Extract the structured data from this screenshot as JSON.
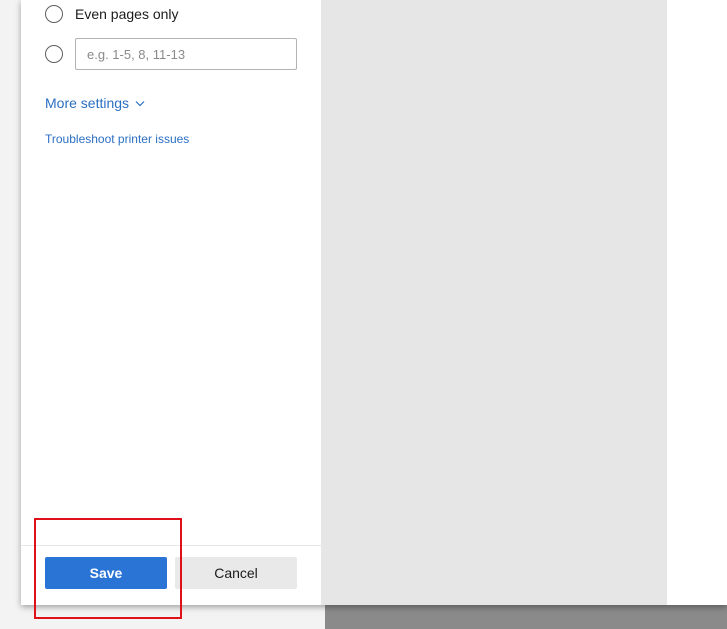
{
  "print_dialog": {
    "page_options": {
      "even_pages_label": "Even pages only",
      "custom_range_placeholder": "e.g. 1-5, 8, 11-13",
      "custom_range_value": ""
    },
    "more_settings_label": "More settings",
    "troubleshoot_label": "Troubleshoot printer issues",
    "footer": {
      "save_label": "Save",
      "cancel_label": "Cancel"
    }
  },
  "colors": {
    "link": "#2b6fc2",
    "primary_button": "#2a74d5",
    "highlight": "#e0101a"
  }
}
